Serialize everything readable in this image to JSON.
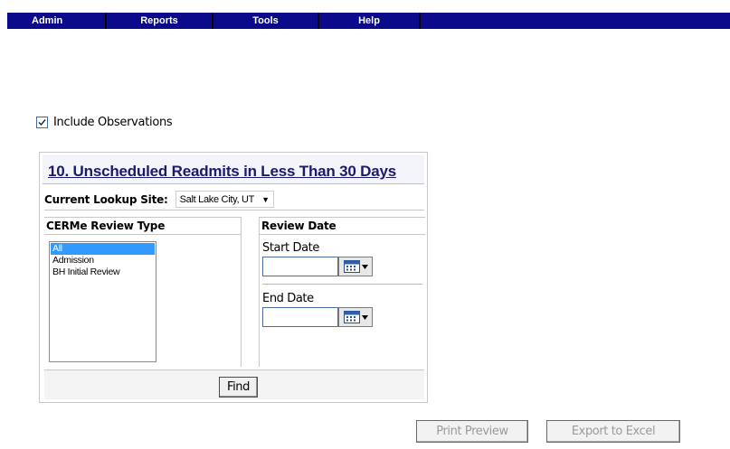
{
  "menu": {
    "items": [
      {
        "label": "Admin"
      },
      {
        "label": "Reports"
      },
      {
        "label": "Tools"
      },
      {
        "label": "Help"
      }
    ]
  },
  "options": {
    "include_observations_label": "Include Observations",
    "include_observations_checked": true
  },
  "report": {
    "title": "10. Unscheduled Readmits in Less Than 30 Days",
    "lookup_label": "Current Lookup Site:",
    "lookup_site": "Salt Lake City, UT",
    "review_type_header": "CERMe Review Type",
    "review_types": [
      "All",
      "Admission",
      "BH Initial Review"
    ],
    "selected_review_type": "All",
    "review_date_header": "Review Date",
    "start_date_label": "Start Date",
    "start_date_value": "",
    "end_date_label": "End Date",
    "end_date_value": "",
    "find_label": "Find"
  },
  "actions": {
    "print_preview_label": "Print Preview",
    "export_excel_label": "Export to Excel"
  },
  "colors": {
    "menubar": "#0a0a8a",
    "title": "#1a1a6e",
    "selected": "#3399ff"
  }
}
